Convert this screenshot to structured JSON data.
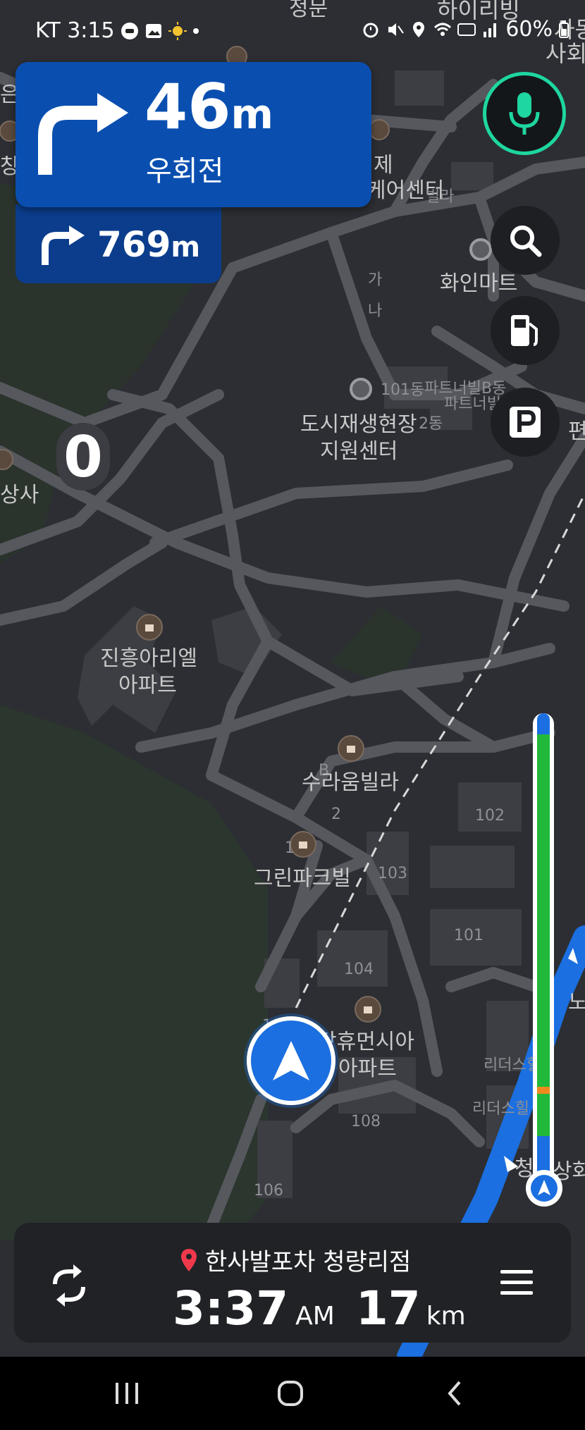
{
  "status_bar": {
    "carrier_time": "KT 3:15",
    "battery": "60%"
  },
  "guidance": {
    "distance_value": "46",
    "distance_unit": "m",
    "road_label": "우회전",
    "next_distance_value": "769",
    "next_distance_unit": "m"
  },
  "speed_limit": "0",
  "map_labels": {
    "top_street": "정문",
    "top_right_1": "하이리빙",
    "top_right_2": "사동",
    "top_right_3": "사회",
    "left_1": "은",
    "left_2": "창",
    "center_1": "제",
    "center_2": "케어센터",
    "center_2b": "빌라",
    "hwain": "화인마트",
    "ga": "가",
    "na": "나",
    "dong_101": "101동",
    "partner_1": "파트너빌B동",
    "partner_2": "파트너빌",
    "dong_2": "2동",
    "urban_center_1": "도시재생현장",
    "urban_center_2": "지원센터",
    "right_edge_1": "편",
    "left_sang": "상사",
    "jinheung_1": "진흥아리엘",
    "jinheung_2": "아파트",
    "b_label": "B",
    "suraum": "수라움빌라",
    "two": "2",
    "greenpark": "그린파크빌",
    "one": "1",
    "b103": "103",
    "b102": "102",
    "b101": "101",
    "b104": "104",
    "humansia_1": "당휴먼시아",
    "humansia_2": "아파트",
    "b108": "108",
    "b106": "106",
    "b10": "10",
    "leaders_1": "리더스힐",
    "leaders_2": "리더스힐",
    "no": "노",
    "cheong": "청",
    "sanghwa": "상화"
  },
  "destination": {
    "name": "한사발포차 청량리점",
    "eta_time": "3:37",
    "eta_ampm": "AM",
    "remaining": "17",
    "remaining_unit": "km"
  },
  "route_progress": 0.04,
  "colors": {
    "accent_blue": "#0a4fb0",
    "mic_ring": "#1ed6a0",
    "route_green": "#22b83a",
    "route_blue": "#1b6fe0"
  },
  "icons": {
    "turn": "turn-right-icon",
    "mic": "mic-icon",
    "search": "search-icon",
    "fuel": "fuel-pump-icon",
    "parking": "parking-icon",
    "reroute": "refresh-route-icon",
    "menu": "hamburger-menu-icon",
    "destination": "location-pin-icon"
  }
}
